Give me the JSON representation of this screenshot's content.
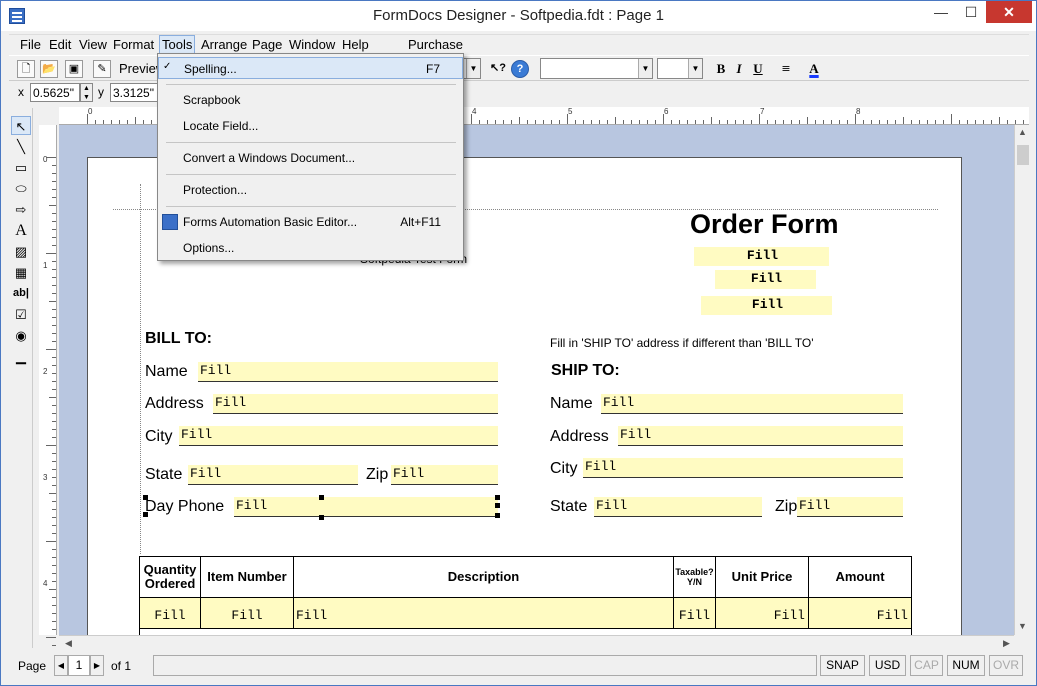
{
  "window": {
    "title": "FormDocs Designer - Softpedia.fdt : Page 1"
  },
  "menubar": {
    "items": [
      "File",
      "Edit",
      "View",
      "Format",
      "Tools",
      "Arrange",
      "Page",
      "Window",
      "Help"
    ],
    "purchase": "Purchase"
  },
  "toolbar": {
    "preview_label": "Preview",
    "help_glyph": "?",
    "bold": "B",
    "italic": "I",
    "underline": "U",
    "fontcolor": "A"
  },
  "position": {
    "x_label": "x",
    "x_value": "0.5625\"",
    "y_label": "y",
    "y_value": "3.3125\""
  },
  "tools_menu": {
    "items": [
      {
        "label": "Spelling...",
        "shortcut": "F7"
      },
      {
        "label": "Scrapbook",
        "shortcut": ""
      },
      {
        "label": "Locate Field...",
        "shortcut": ""
      },
      {
        "label": "Convert a Windows Document...",
        "shortcut": ""
      },
      {
        "label": "Protection...",
        "shortcut": ""
      },
      {
        "label": "Forms Automation Basic Editor...",
        "shortcut": "Alt+F11"
      },
      {
        "label": "Options...",
        "shortcut": ""
      }
    ]
  },
  "form": {
    "title": "Order Form",
    "subtitle": "Softpedia Test Form",
    "fill": "Fill",
    "bill_to": "BILL TO:",
    "ship_to": "SHIP TO:",
    "ship_note": "Fill in 'SHIP TO' address if different than 'BILL TO'",
    "labels": {
      "name": "Name",
      "address": "Address",
      "city": "City",
      "state": "State",
      "zip": "Zip",
      "day_phone": "Day Phone"
    },
    "table_headers": [
      "Quantity Ordered",
      "Item Number",
      "Description",
      "Taxable? Y/N",
      "Unit Price",
      "Amount"
    ]
  },
  "ruler": {
    "h_numbers": [
      "0",
      "1",
      "2",
      "3",
      "4",
      "5",
      "6",
      "7",
      "8"
    ],
    "v_numbers": [
      "0",
      "1",
      "2",
      "3",
      "4"
    ]
  },
  "statusbar": {
    "page_label": "Page",
    "page_number": "1",
    "of_label": "of 1",
    "snap": "SNAP",
    "usd": "USD",
    "cap": "CAP",
    "num": "NUM",
    "ovr": "OVR"
  }
}
